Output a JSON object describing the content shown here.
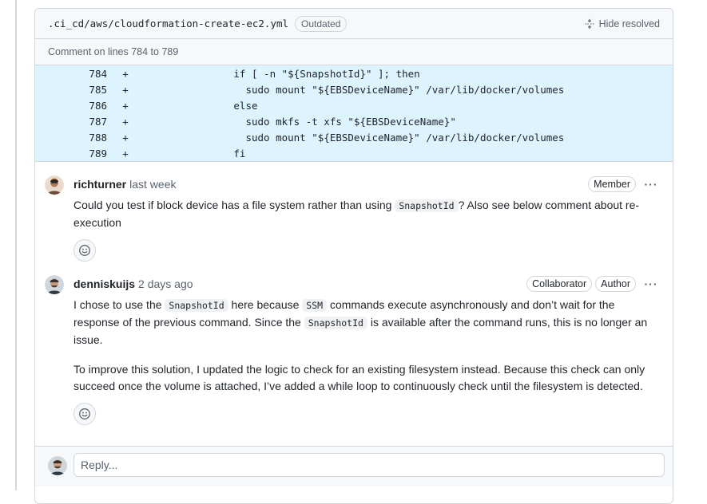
{
  "file_header": {
    "path": ".ci_cd/aws/cloudformation-create-ec2.yml",
    "outdated_label": "Outdated",
    "hide_resolved_label": "Hide resolved"
  },
  "comment_range": "Comment on lines 784 to 789",
  "diff_lines": [
    {
      "num": "784",
      "sign": "+",
      "code": "                if [ -n \"${SnapshotId}\" ]; then"
    },
    {
      "num": "785",
      "sign": "+",
      "code": "                  sudo mount \"${EBSDeviceName}\" /var/lib/docker/volumes"
    },
    {
      "num": "786",
      "sign": "+",
      "code": "                else"
    },
    {
      "num": "787",
      "sign": "+",
      "code": "                  sudo mkfs -t xfs \"${EBSDeviceName}\""
    },
    {
      "num": "788",
      "sign": "+",
      "code": "                  sudo mount \"${EBSDeviceName}\" /var/lib/docker/volumes"
    },
    {
      "num": "789",
      "sign": "+",
      "code": "                fi"
    }
  ],
  "comments": [
    {
      "author": "richturner",
      "time": "last week",
      "badges": [
        "Member"
      ],
      "body": {
        "p1_a": "Could you test if block device has a file system rather than using ",
        "p1_code": "SnapshotId",
        "p1_b": "? Also see below comment about re-execution"
      }
    },
    {
      "author": "denniskuijs",
      "time": "2 days ago",
      "badges": [
        "Collaborator",
        "Author"
      ],
      "body": {
        "p1_a": "I chose to use the ",
        "p1_code1": "SnapshotId",
        "p1_b": " here because ",
        "p1_code2": "SSM",
        "p1_c": " commands execute asynchronously and don’t wait for the response of the previous command. Since the ",
        "p1_code3": "SnapshotId",
        "p1_d": " is available after the command runs, this is no longer an issue.",
        "p2": "To improve this solution, I updated the logic to check for an existing filesystem instead. Because this check can only succeed once the volume is attached, I’ve added a while loop to continuously check until the filesystem is detected."
      }
    }
  ],
  "reply": {
    "placeholder": "Reply..."
  },
  "icons": {
    "more": "kebab-horizontal-icon",
    "reaction": "smiley-icon",
    "unfold": "unfold-icon"
  },
  "colors": {
    "diff_bg": "#ddf4ff",
    "border": "#d0d7de",
    "muted": "#59636e"
  }
}
